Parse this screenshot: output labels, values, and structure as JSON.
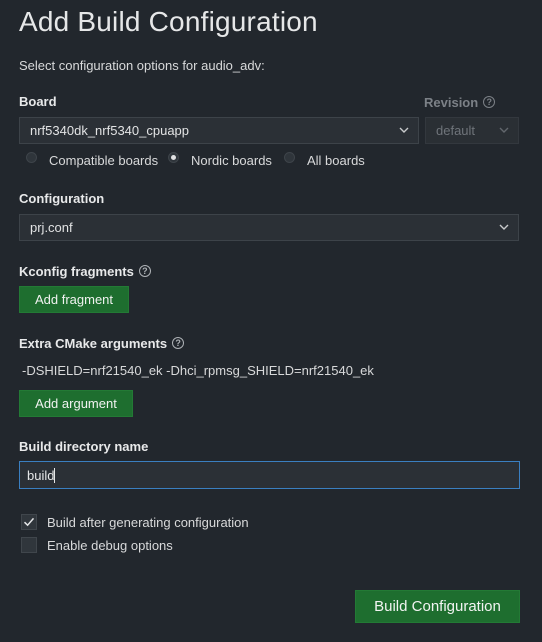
{
  "header": {
    "title": "Add Build Configuration",
    "subtitle": "Select configuration options for audio_adv:"
  },
  "board": {
    "label": "Board",
    "selected": "nrf5340dk_nrf5340_cpuapp",
    "revision_label": "Revision",
    "revision_value": "default",
    "filter_options": [
      {
        "label": "Compatible boards",
        "checked": false
      },
      {
        "label": "Nordic boards",
        "checked": true
      },
      {
        "label": "All boards",
        "checked": false
      }
    ]
  },
  "configuration": {
    "label": "Configuration",
    "selected": "prj.conf"
  },
  "kconfig": {
    "label": "Kconfig fragments",
    "add_button": "Add fragment"
  },
  "cmake": {
    "label": "Extra CMake arguments",
    "value": "-DSHIELD=nrf21540_ek -Dhci_rpmsg_SHIELD=nrf21540_ek",
    "add_button": "Add argument"
  },
  "build_dir": {
    "label": "Build directory name",
    "value": "build"
  },
  "options": [
    {
      "label": "Build after generating configuration",
      "checked": true
    },
    {
      "label": "Enable debug options",
      "checked": false
    }
  ],
  "footer": {
    "submit_label": "Build Configuration"
  },
  "colors": {
    "background": "#22272d",
    "accent_green": "#1e6e2f",
    "focus_blue": "#3a7fc1"
  }
}
